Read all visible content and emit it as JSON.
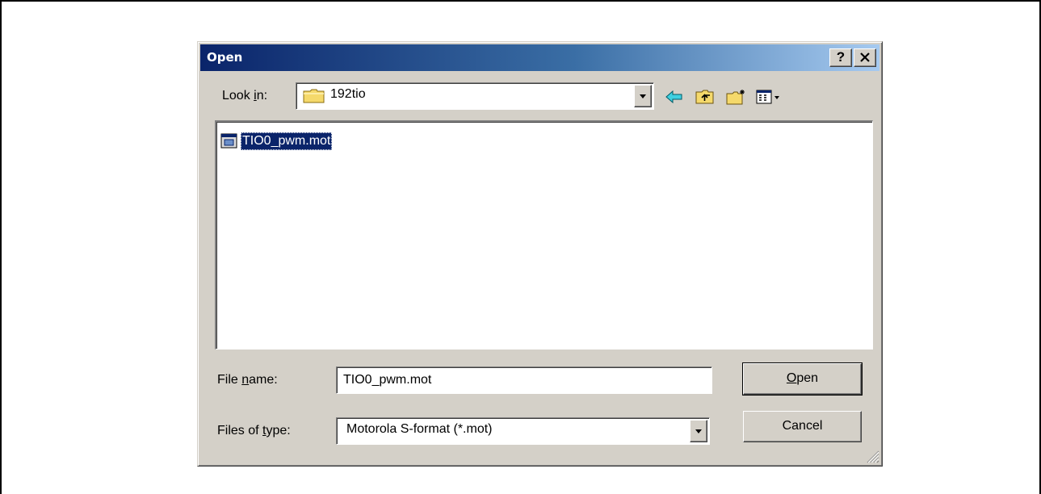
{
  "dialog": {
    "title": "Open",
    "help_label": "?",
    "close_label": "✕"
  },
  "lookin": {
    "label_pre": "Look ",
    "label_key": "i",
    "label_post": "n:",
    "value": "192tio"
  },
  "files": [
    {
      "name": "TIO0_pwm.mot",
      "selected": true
    }
  ],
  "filename": {
    "label_pre": "File ",
    "label_key": "n",
    "label_post": "ame:",
    "value": "TIO0_pwm.mot"
  },
  "filetype": {
    "label_pre": "Files of ",
    "label_key": "t",
    "label_post": "ype:",
    "value": "Motorola S-format (*.mot)"
  },
  "buttons": {
    "open_key": "O",
    "open_rest": "pen",
    "cancel": "Cancel"
  },
  "colors": {
    "title_gradient_start": "#0a246a",
    "title_gradient_end": "#a6caf0",
    "face": "#d4d0c8",
    "selection": "#0a246a"
  }
}
